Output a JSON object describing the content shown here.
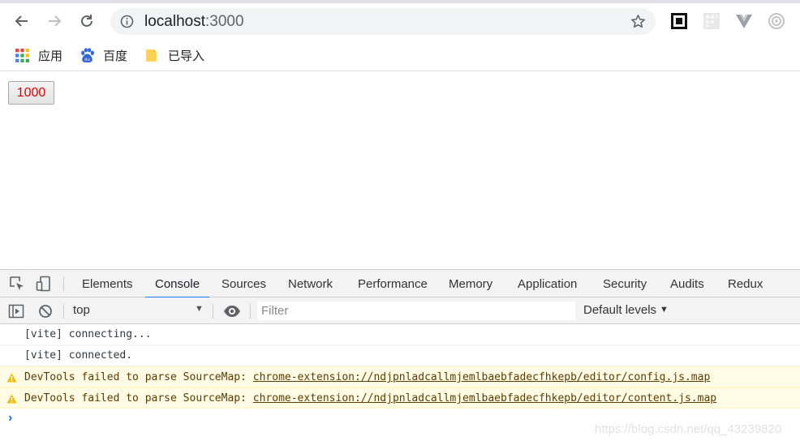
{
  "browser": {
    "url_host": "localhost",
    "url_port": ":3000",
    "bookmarks": [
      {
        "label": "应用",
        "icon": "apps-grid-icon"
      },
      {
        "label": "百度",
        "icon": "baidu-paw-icon"
      },
      {
        "label": "已导入",
        "icon": "folder-icon"
      }
    ]
  },
  "page": {
    "counter_label": "1000",
    "counter_color": "#e00000"
  },
  "devtools": {
    "tabs": [
      "Elements",
      "Console",
      "Sources",
      "Network",
      "Performance",
      "Memory",
      "Application",
      "Security",
      "Audits",
      "Redux"
    ],
    "active_tab": "Console",
    "context": "top",
    "filter_placeholder": "Filter",
    "levels": "Default levels",
    "messages": [
      {
        "type": "log",
        "text": "[vite] connecting..."
      },
      {
        "type": "log",
        "text": "[vite] connected."
      },
      {
        "type": "warning",
        "text": "DevTools failed to parse SourceMap: ",
        "link": "chrome-extension://ndjpnladcallmjemlbaebfadecfhkepb/editor/config.js.map"
      },
      {
        "type": "warning",
        "text": "DevTools failed to parse SourceMap: ",
        "link": "chrome-extension://ndjpnladcallmjemlbaebfadecfhkepb/editor/content.js.map"
      }
    ],
    "prompt": "›"
  },
  "watermark": "https://blog.csdn.net/qq_43239820",
  "colors": {
    "accent": "#1a73e8",
    "warning_bg": "#fffbe5",
    "warning_text": "#5c3c00"
  }
}
